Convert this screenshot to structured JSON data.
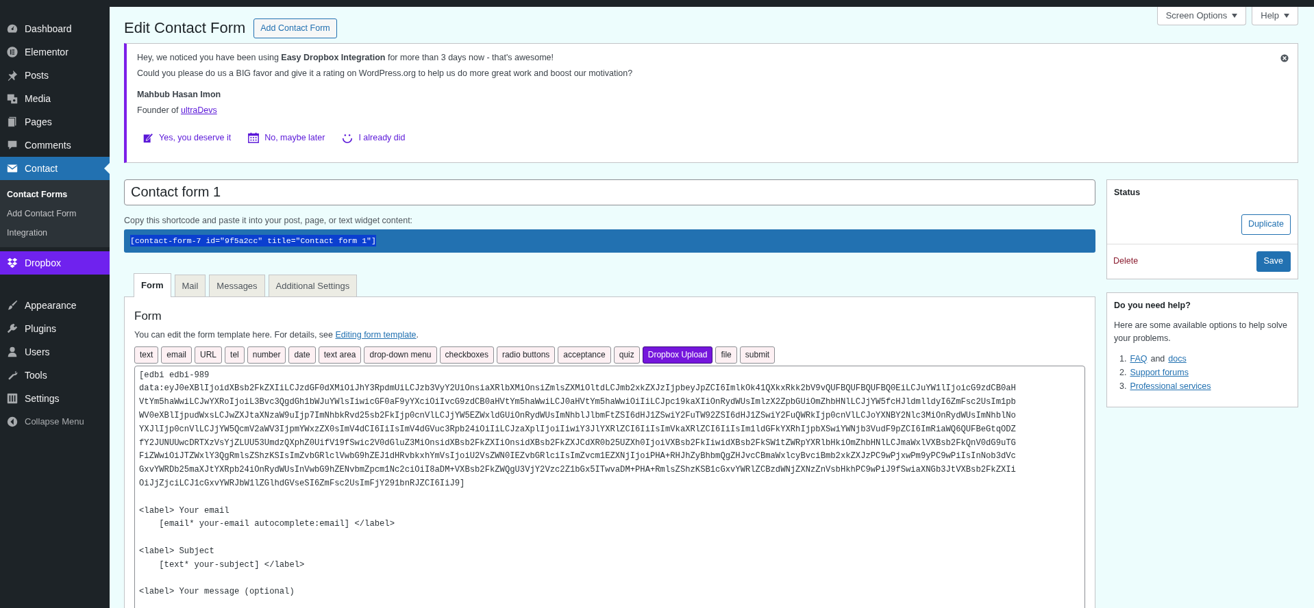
{
  "admin_menu": {
    "groups": [
      [
        {
          "label": "Dashboard",
          "kind": "item",
          "selected": false
        },
        {
          "label": "Elementor",
          "kind": "item",
          "selected": false
        },
        {
          "label": "Posts",
          "kind": "item",
          "selected": false
        },
        {
          "label": "Media",
          "kind": "item",
          "selected": false
        },
        {
          "label": "Pages",
          "kind": "item",
          "selected": false
        },
        {
          "label": "Comments",
          "kind": "item",
          "selected": false
        },
        {
          "label": "Contact",
          "kind": "item",
          "selected": true,
          "children": [
            {
              "label": "Contact Forms",
              "selected": true
            },
            {
              "label": "Add Contact Form",
              "selected": false
            },
            {
              "label": "Integration",
              "selected": false
            }
          ]
        },
        {
          "label": "Dropbox",
          "kind": "promo",
          "selected": false
        }
      ],
      [
        {
          "label": "Appearance",
          "kind": "item",
          "selected": false
        },
        {
          "label": "Plugins",
          "kind": "item",
          "selected": false
        },
        {
          "label": "Users",
          "kind": "item",
          "selected": false
        },
        {
          "label": "Tools",
          "kind": "item",
          "selected": false
        },
        {
          "label": "Settings",
          "kind": "item",
          "selected": false
        },
        {
          "label": "Collapse Menu",
          "kind": "collapse",
          "selected": false
        }
      ]
    ]
  },
  "screen_tabs": [
    "Screen Options",
    "Help"
  ],
  "page_title": "Edit Contact Form",
  "add_button": "Add Contact Form",
  "notice": {
    "lines": [
      "Hey, we noticed you have been using **Easy Dropbox Integration** for more than 3 days now - that's awesome!",
      "Could you please do us a BIG favor and give it a rating on WordPress.org to help us do more great work and boost our motivation?"
    ],
    "author": "Mahbub Hasan Imon",
    "role": "Founder of",
    "company_link": "ultraDevs",
    "actions": [
      "Yes, you deserve it",
      "No, maybe later",
      "I already did"
    ]
  },
  "form_title": "Contact form 1",
  "shortcode_hint": "Copy this shortcode and paste it into your post, page, or text widget content:",
  "shortcode": "[contact-form-7 id=\"9f5a2cc\" title=\"Contact form 1\"]",
  "tabs": [
    {
      "label": "Form",
      "selected": true
    },
    {
      "label": "Mail",
      "selected": false
    },
    {
      "label": "Messages",
      "selected": false
    },
    {
      "label": "Additional Settings",
      "selected": false
    }
  ],
  "panel": {
    "heading": "Form",
    "description": "You can edit the form template here. For details, see",
    "description_link": "Editing form template",
    "description_end": ".",
    "tag_buttons": [
      {
        "label": "text",
        "kind": "tag"
      },
      {
        "label": "email",
        "kind": "tag"
      },
      {
        "label": "URL",
        "kind": "tag"
      },
      {
        "label": "tel",
        "kind": "tag"
      },
      {
        "label": "number",
        "kind": "tag"
      },
      {
        "label": "date",
        "kind": "tag"
      },
      {
        "label": "text area",
        "kind": "tag"
      },
      {
        "label": "drop-down menu",
        "kind": "tag"
      },
      {
        "label": "checkboxes",
        "kind": "tag"
      },
      {
        "label": "radio buttons",
        "kind": "tag"
      },
      {
        "label": "acceptance",
        "kind": "tag"
      },
      {
        "label": "quiz",
        "kind": "tag"
      },
      {
        "label": "Dropbox Upload",
        "kind": "plugin"
      },
      {
        "label": "file",
        "kind": "tag"
      },
      {
        "label": "submit",
        "kind": "tag"
      }
    ],
    "template_blocks": [
      [
        "[edbi edbi-989",
        "data:eyJ0eXBlIjoidXBsb2FkZXIiLCJzdGF0dXMiOiJhY3RpdmUiLCJzb3VyY2UiOnsiaXRlbXMiOnsiZmlsZXMiOltdLCJmb2xkZXJzIjpbeyJpZCI6ImlkOk41QXkxRkk2bV9vQUFBQUFBQUFBQ0EiLCJuYW1lIjoicG9zdCB0aH",
        "VtYm5haWwiLCJwYXRoIjoiL3Bvc3QgdGh1bWJuYWlsIiwicGF0aF9yYXciOiIvcG9zdCB0aHVtYm5haWwiLCJ0aHVtYm5haWwiOiIiLCJpc19kaXIiOnRydWUsImlzX2ZpbGUiOmZhbHNlLCJjYW5fcHJldmlldyI6ZmFsc2UsIm1pb",
        "WV0eXBlIjpudWxsLCJwZXJtaXNzaW9uIjp7ImNhbkRvd25sb2FkIjp0cnVlLCJjYW5EZWxldGUiOnRydWUsImNhblJlbmFtZSI6dHJ1ZSwiY2FuTW92ZSI6dHJ1ZSwiY2FuQWRkIjp0cnVlLCJoYXNBY2Nlc3MiOnRydWUsImNhblNo",
        "YXJlIjp0cnVlLCJjYW5QcmV2aWV3IjpmYWxzZX0sImV4dCI6IiIsImV4dGVuc3Rpb24iOiIiLCJzaXplIjoiIiwiY3JlYXRlZCI6IiIsImVkaXRlZCI6IiIsIm1ldGFkYXRhIjpbXSwiYWNjb3VudF9pZCI6ImRiaWQ6QUFBeGtqODZ",
        "fY2JUNUUwcDRTXzVsYjZLUU53UmdzQXphZ0UifV19fSwic2V0dGluZ3MiOnsidXBsb2FkZXIiOnsidXBsb2FkZXJCdXR0b25UZXh0IjoiVXBsb2FkIiwidXBsb2FkSW1tZWRpYXRlbHkiOmZhbHNlLCJmaWxlVXBsb2FkQnV0dG9uTG",
        "FiZWwiOiJTZWxlY3QgRmlsZShzKSIsImZvbGRlclVwbG9hZEJ1dHRvbkxhYmVsIjoiU2VsZWN0IEZvbGRlciIsImZvcm1EZXNjIjoiPHA+RHJhZyBhbmQgZHJvcCBmaWxlcyBvciBmb2xkZXJzPC9wPjxwPm9yPC9wPiIsInNob3dVc",
        "GxvYWRDb25maXJtYXRpb24iOnRydWUsInVwbG9hZENvbmZpcm1Nc2ciOiI8aDM+VXBsb2FkZWQgU3VjY2Vzc2Z1bGx5ITwvaDM+PHA+RmlsZShzKSB1cGxvYWRlZCBzdWNjZXNzZnVsbHkhPC9wPiJ9fSwiaXNGb3JtVXBsb2FkZXIi",
        "OiJjZjciLCJ1cGxvYWRJbW1lZGlhdGVseSI6ZmFsc2UsImFjY291bnRJZCI6IiJ9]"
      ],
      [
        "<label> Your email",
        "    [email* your-email autocomplete:email] </label>"
      ],
      [
        "<label> Subject",
        "    [text* your-subject] </label>"
      ],
      [
        "<label> Your message (optional)"
      ]
    ]
  },
  "status_box": {
    "heading": "Status",
    "duplicate": "Duplicate",
    "delete": "Delete",
    "save": "Save"
  },
  "help_box": {
    "heading": "Do you need help?",
    "text": "Here are some available options to help solve your problems.",
    "items": [
      {
        "number": "1.",
        "parts": [
          {
            "text": "FAQ",
            "link": true
          },
          {
            "text": "and",
            "link": false
          },
          {
            "text": "docs",
            "link": true
          }
        ]
      },
      {
        "number": "2.",
        "parts": [
          {
            "text": "Support forums",
            "link": true
          }
        ]
      },
      {
        "number": "3.",
        "parts": [
          {
            "text": "Professional services",
            "link": true
          }
        ]
      }
    ]
  }
}
